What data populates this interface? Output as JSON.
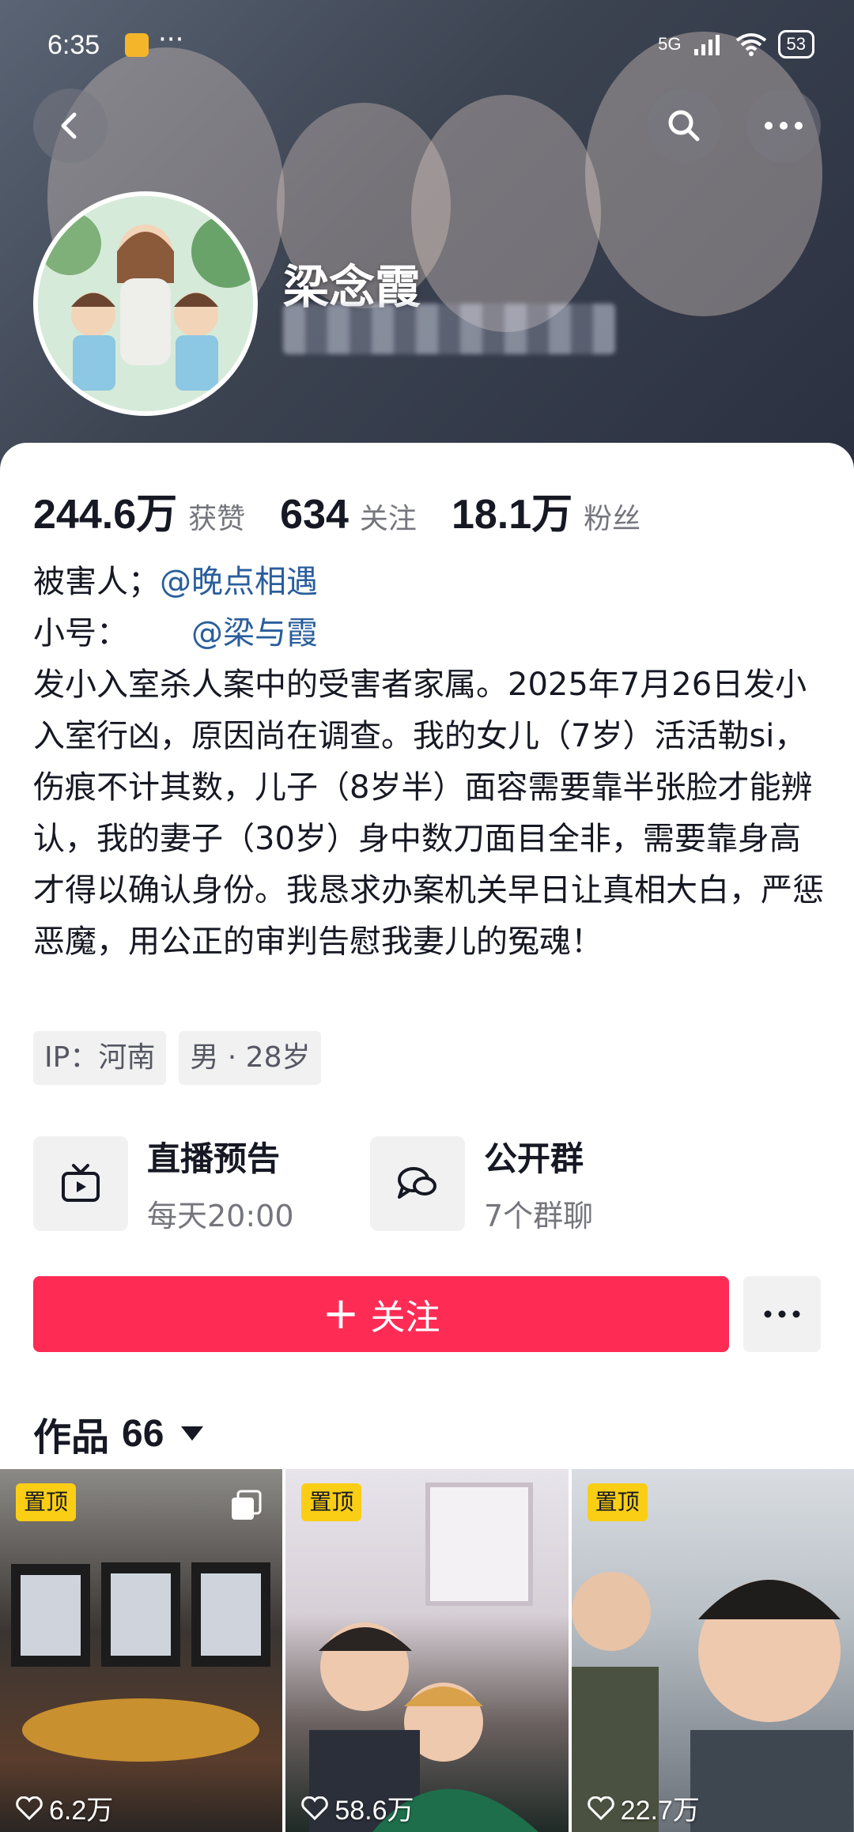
{
  "status_bar": {
    "time": "6:35",
    "network": "5G",
    "battery": "53"
  },
  "profile": {
    "name": "梁念霞"
  },
  "stats": [
    {
      "value": "244.6万",
      "label": "获赞"
    },
    {
      "value": "634",
      "label": "关注"
    },
    {
      "value": "18.1万",
      "label": "粉丝"
    }
  ],
  "bio": {
    "line1_prefix": "被害人；",
    "line1_mention": "@晚点相遇",
    "line2_prefix": "小号：",
    "line2_mention": "@梁与霞",
    "text": "发小入室杀人案中的受害者家属。2025年7月26日发小入室行凶，原因尚在调查。我的女儿（7岁）活活勒si，伤痕不计其数，儿子（8岁半）面容需要靠半张脸才能辨认，我的妻子（30岁）身中数刀面目全非，需要靠身高才得以确认身份。我恳求办案机关早日让真相大白，严惩恶魔，用公正的审判告慰我妻儿的冤魂！"
  },
  "tags": [
    "IP：河南",
    "男 · 28岁"
  ],
  "cards": [
    {
      "title": "直播预告",
      "subtitle": "每天20:00",
      "icon": "tv-icon"
    },
    {
      "title": "公开群",
      "subtitle": "7个群聊",
      "icon": "chat-bubble-icon"
    }
  ],
  "actions": {
    "follow_label": "关注"
  },
  "works": {
    "label": "作品",
    "count": "66"
  },
  "videos": [
    {
      "pinned_label": "置顶",
      "likes": "6.2万"
    },
    {
      "pinned_label": "置顶",
      "likes": "58.6万"
    },
    {
      "pinned_label": "置顶",
      "likes": "22.7万"
    }
  ],
  "colors": {
    "accent": "#fe2c55",
    "mention": "#2a5e9c",
    "pin_badge": "#face15"
  }
}
